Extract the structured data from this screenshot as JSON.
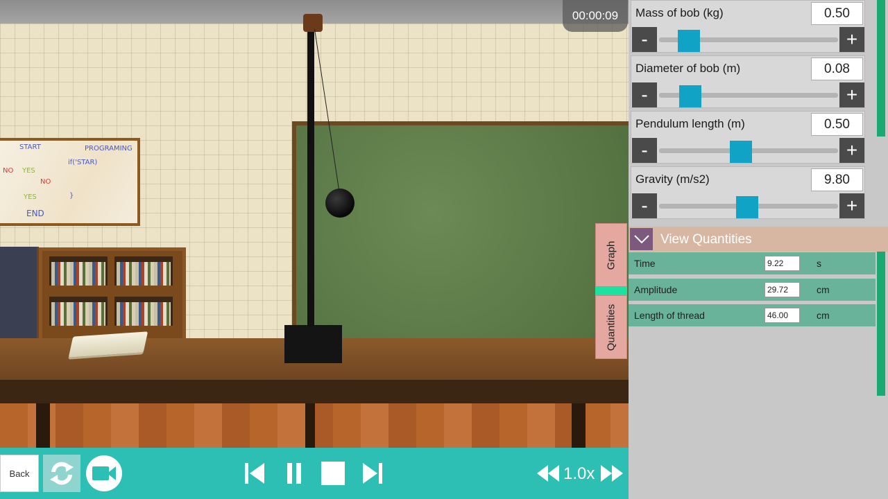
{
  "timer": "00:00:09",
  "whiteboard": {
    "texts": [
      "START",
      "PROGRAMING",
      "NO",
      "YES",
      "if('STAR)",
      "NO",
      "YES",
      "}",
      "END"
    ]
  },
  "parameters": [
    {
      "label": "Mass of bob (kg)",
      "value": "0.50",
      "slider_fraction": 0.12
    },
    {
      "label": "Diameter of bob (m)",
      "value": "0.08",
      "slider_fraction": 0.13
    },
    {
      "label": "Pendulum length (m)",
      "value": "0.50",
      "slider_fraction": 0.45
    },
    {
      "label": "Gravity (m/s2)",
      "value": "9.80",
      "slider_fraction": 0.49
    }
  ],
  "param_buttons": {
    "minus": "-",
    "plus": "+"
  },
  "side_tabs": {
    "graph": "Graph",
    "quantities": "Quantities"
  },
  "view_quantities": {
    "title": "View Quantities",
    "rows": [
      {
        "label": "Time",
        "value": "9.22",
        "unit": "s"
      },
      {
        "label": "Amplitude",
        "value": "29.72",
        "unit": "cm"
      },
      {
        "label": "Length of thread",
        "value": "46.00",
        "unit": "cm"
      }
    ]
  },
  "toolbar": {
    "back_label": "Back",
    "speed": "1.0x"
  },
  "icons": {
    "reset": "refresh-icon",
    "camera": "video-camera-icon",
    "prev": "skip-previous-icon",
    "pause": "pause-icon",
    "stop": "stop-icon",
    "next": "skip-next-icon",
    "rewind": "rewind-icon",
    "fast_forward": "fast-forward-icon",
    "collapse": "chevron-down-icon"
  },
  "colors": {
    "toolbar": "#2dbfb4",
    "slider_thumb": "#11a3c5",
    "quantity_row": "#69b39b",
    "header": "#d8b7a2",
    "scrollbar": "#1ca873"
  }
}
